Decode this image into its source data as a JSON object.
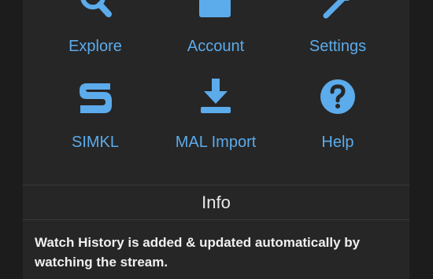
{
  "menu": {
    "items": [
      {
        "label": "Explore",
        "icon": "search-icon"
      },
      {
        "label": "Account",
        "icon": "account-icon"
      },
      {
        "label": "Settings",
        "icon": "wrench-icon"
      },
      {
        "label": "SIMKL",
        "icon": "simkl-logo-icon"
      },
      {
        "label": "MAL Import",
        "icon": "download-icon"
      },
      {
        "label": "Help",
        "icon": "help-icon"
      }
    ]
  },
  "info": {
    "title": "Info",
    "text": "Watch History is added & updated automatically by watching the stream."
  },
  "colors": {
    "accent": "#5cabeb",
    "panel": "#262626",
    "background": "#1c1c1c"
  }
}
